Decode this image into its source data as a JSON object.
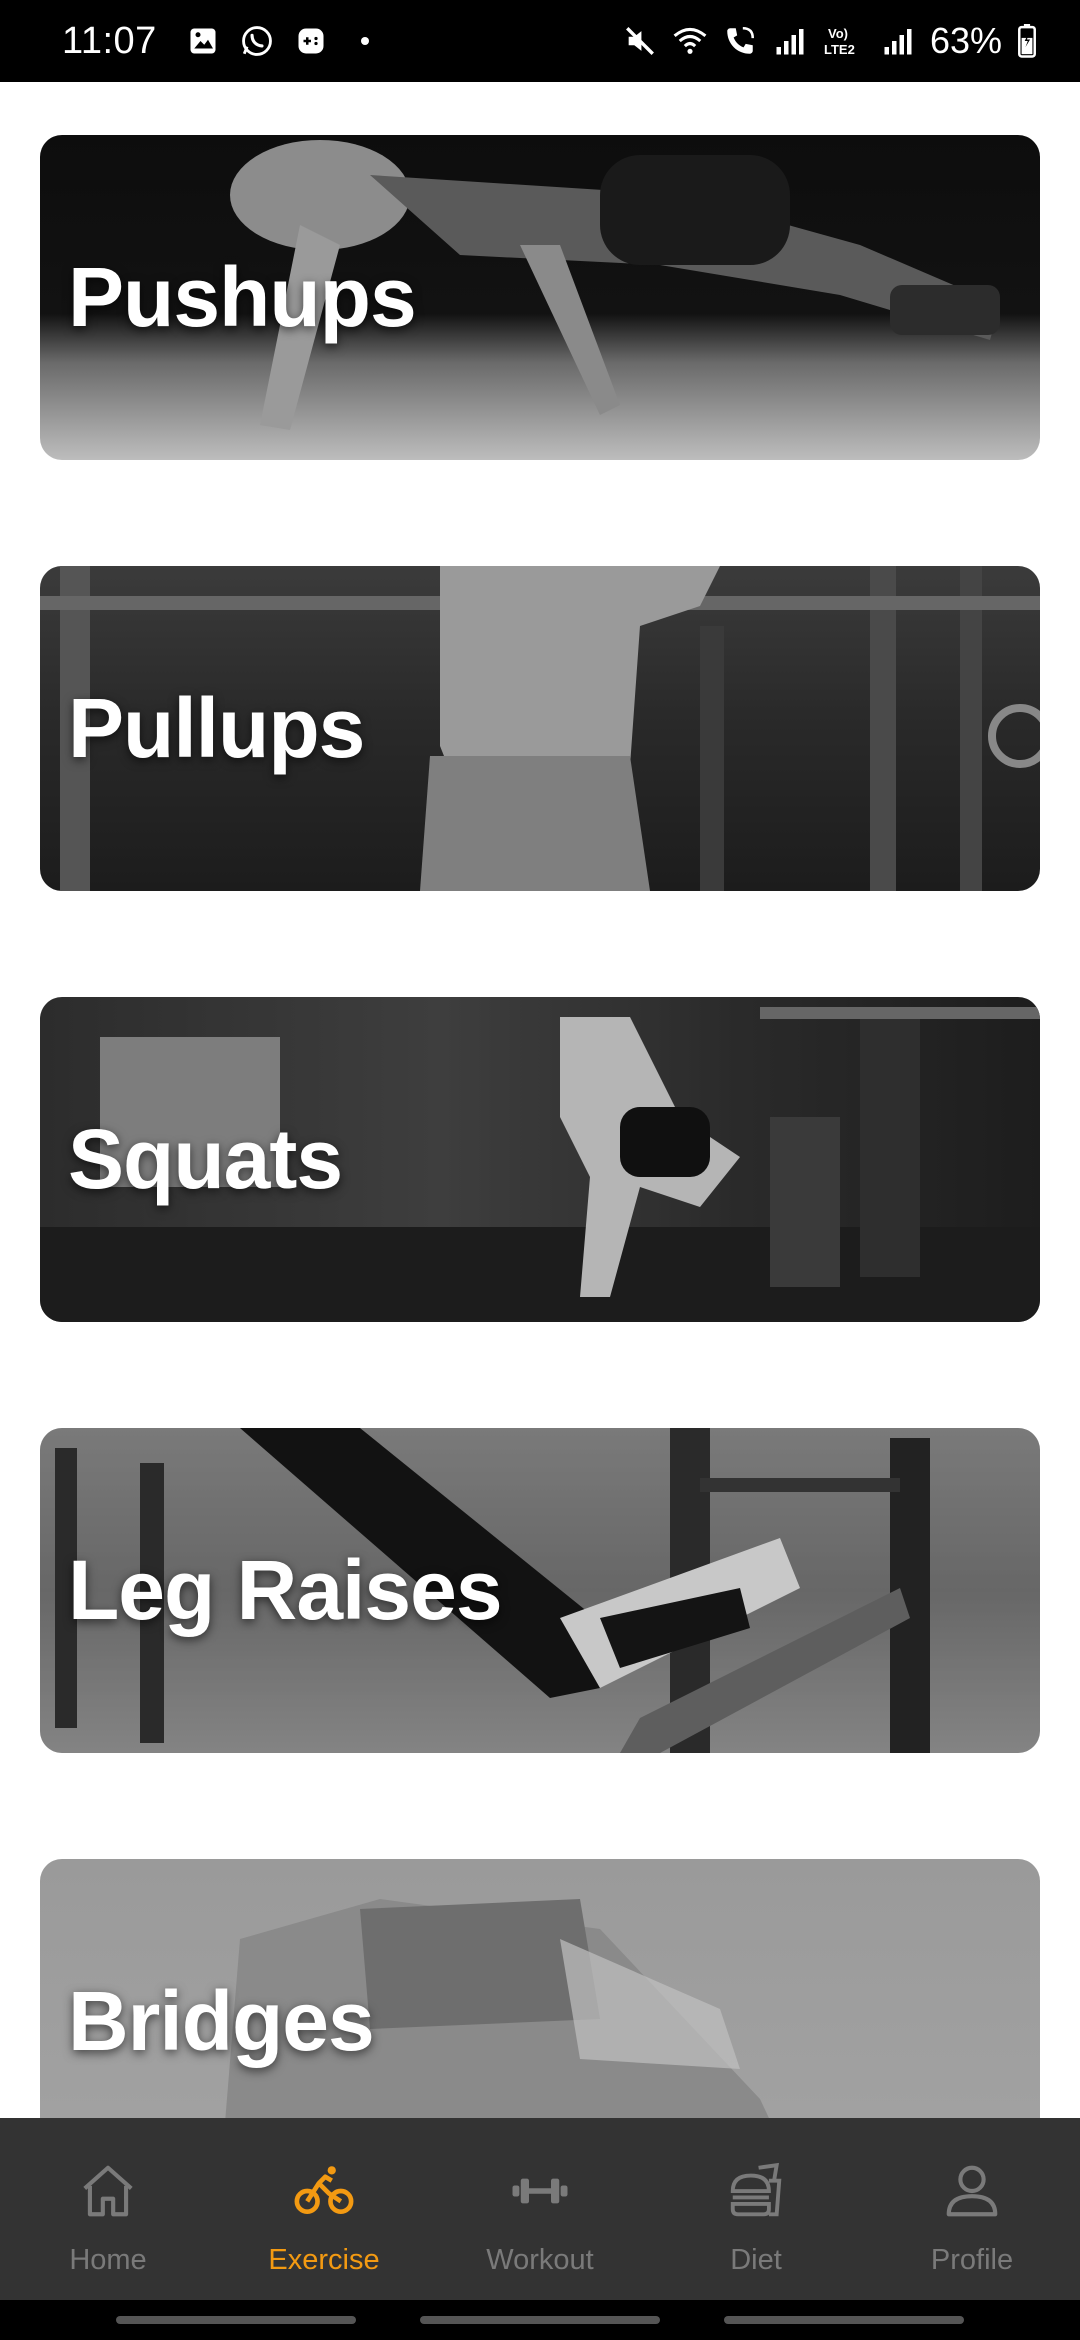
{
  "status_bar": {
    "time": "11:07",
    "battery": "63%",
    "left_icons": [
      "gallery-icon",
      "whatsapp-icon",
      "game-icon",
      "dot-icon"
    ],
    "right_icons": [
      "mute-icon",
      "wifi-icon",
      "wifi-calling-icon",
      "signal-icon",
      "volte-icon",
      "signal-icon",
      "battery-icon"
    ],
    "volte_label": "Vo)\nLTE2"
  },
  "exercises": [
    {
      "title": "Pushups"
    },
    {
      "title": "Pullups"
    },
    {
      "title": "Squats"
    },
    {
      "title": "Leg Raises"
    },
    {
      "title": "Bridges"
    }
  ],
  "nav": {
    "items": [
      {
        "label": "Home",
        "icon": "home-icon",
        "active": false
      },
      {
        "label": "Exercise",
        "icon": "bicycle-icon",
        "active": true
      },
      {
        "label": "Workout",
        "icon": "dumbbell-icon",
        "active": false
      },
      {
        "label": "Diet",
        "icon": "food-icon",
        "active": false
      },
      {
        "label": "Profile",
        "icon": "user-icon",
        "active": false
      }
    ],
    "active_color": "#f39a12",
    "inactive_color": "#7a7a7a",
    "background": "#333333"
  }
}
